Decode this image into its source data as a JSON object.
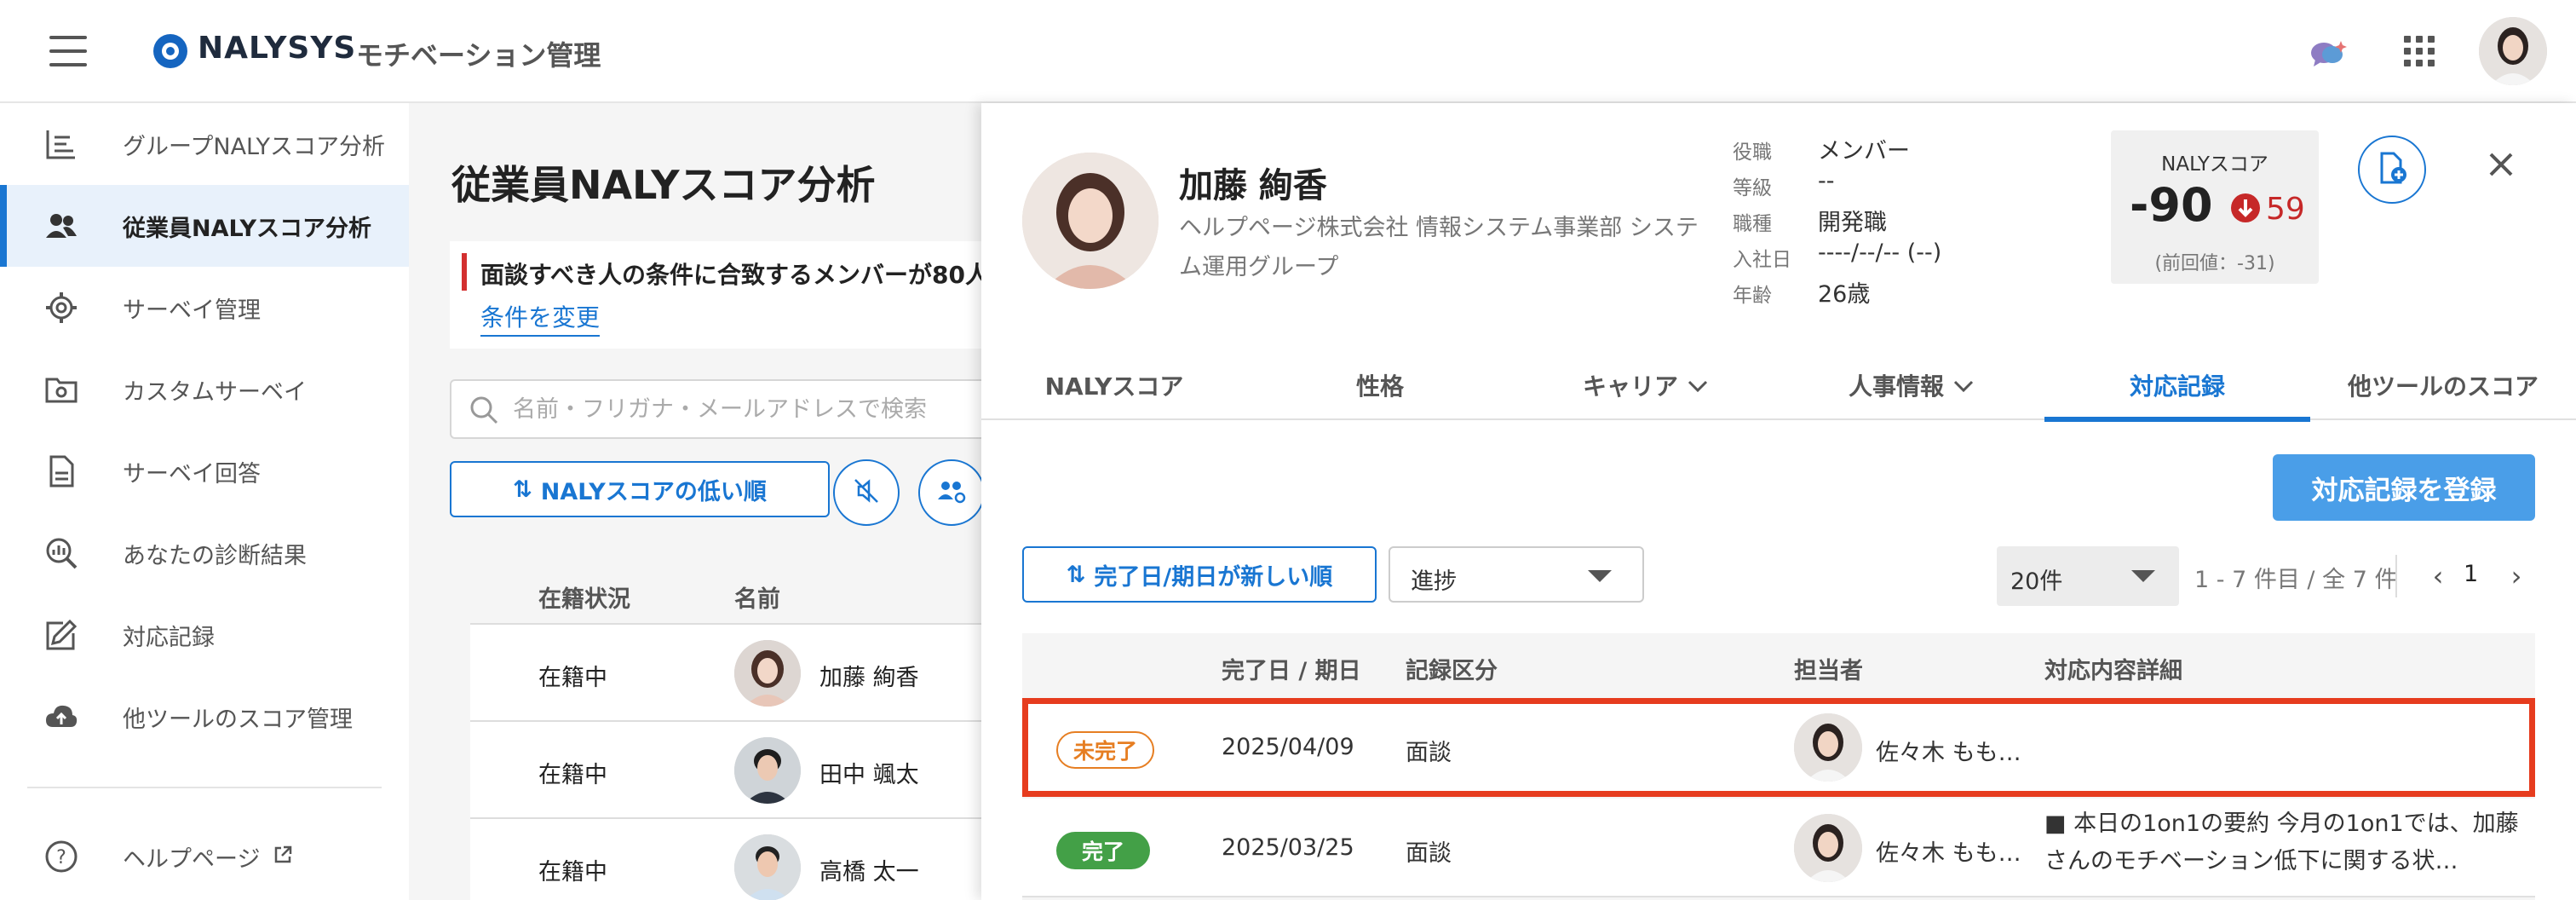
{
  "header": {
    "brand": "NALYSYS",
    "app_name": "モチベーション管理",
    "icons": [
      "menu-icon",
      "chat-sparkle-icon",
      "apps-grid-icon",
      "user-avatar"
    ]
  },
  "sidebar": {
    "items": [
      {
        "label": "グループNALYスコア分析",
        "icon": "chart-list-icon"
      },
      {
        "label": "従業員NALYスコア分析",
        "icon": "people-icon",
        "active": true
      },
      {
        "label": "サーベイ管理",
        "icon": "gear-icon"
      },
      {
        "label": "カスタムサーベイ",
        "icon": "folder-gear-icon"
      },
      {
        "label": "サーベイ回答",
        "icon": "document-icon"
      },
      {
        "label": "あなたの診断結果",
        "icon": "search-chart-icon"
      },
      {
        "label": "対応記録",
        "icon": "edit-icon"
      },
      {
        "label": "他ツールのスコア管理",
        "icon": "cloud-upload-icon"
      }
    ],
    "help": {
      "label": "ヘルプページ",
      "icon": "help-icon"
    }
  },
  "main": {
    "title": "従業員NALYスコア分析",
    "alert": {
      "text": "面談すべき人の条件に合致するメンバーが80人",
      "link": "条件を変更"
    },
    "search_placeholder": "名前・フリガナ・メールアドレスで検索",
    "sort_label": "NALYスコアの低い順",
    "table": {
      "headers": [
        "在籍状況",
        "名前"
      ],
      "rows": [
        {
          "status": "在籍中",
          "name": "加藤 絢香"
        },
        {
          "status": "在籍中",
          "name": "田中 颯太"
        },
        {
          "status": "在籍中",
          "name": "高橋 太一"
        }
      ]
    }
  },
  "panel": {
    "name": "加藤 絢香",
    "org": "ヘルプページ株式会社 情報システム事業部 システム運用グループ",
    "info": [
      {
        "k": "役職",
        "v": "メンバー"
      },
      {
        "k": "等級",
        "v": "--"
      },
      {
        "k": "職種",
        "v": "開発職"
      },
      {
        "k": "入社日",
        "v": "----/--/--  (--)"
      },
      {
        "k": "年齢",
        "v": "26歳"
      }
    ],
    "score": {
      "label": "NALYスコア",
      "value": "-90",
      "delta": "59",
      "previous": "(前回値：-31)"
    },
    "tabs": [
      {
        "label": "NALYスコア"
      },
      {
        "label": "性格"
      },
      {
        "label": "キャリア",
        "dropdown": true
      },
      {
        "label": "人事情報",
        "dropdown": true
      },
      {
        "label": "対応記録",
        "active": true
      },
      {
        "label": "他ツールのスコア"
      }
    ],
    "register_button": "対応記録を登録",
    "sort_label": "完了日/期日が新しい順",
    "progress_select": "進捗",
    "per_page": "20件",
    "pager_info": "1 - 7 件目 / 全 7 件",
    "page": "1",
    "records": {
      "headers": [
        "完了日 / 期日",
        "記録区分",
        "担当者",
        "対応内容詳細"
      ],
      "rows": [
        {
          "status": "未完了",
          "date": "2025/04/09",
          "category": "面談",
          "person": "佐々木 もも…",
          "detail": "",
          "highlight": true
        },
        {
          "status": "完了",
          "date": "2025/03/25",
          "category": "面談",
          "person": "佐々木 もも…",
          "detail": "■ 本日の1on1の要約 今月の1on1では、加藤さんのモチベーション低下に関する状…"
        }
      ]
    }
  },
  "colors": {
    "accent": "#1976d2",
    "active_bg": "#e8f1fb",
    "alert": "#d32f2f",
    "pending": "#e67e22",
    "done": "#43a047",
    "highlight_box": "#e63c1e",
    "score_down": "#c62828"
  }
}
